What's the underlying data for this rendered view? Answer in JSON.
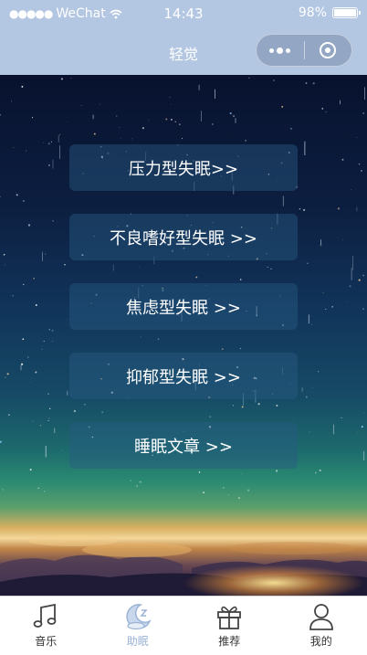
{
  "status_bar": {
    "carrier": "WeChat",
    "time": "14:43",
    "battery": "98%",
    "battery_level": 0.98
  },
  "nav": {
    "title": "轻觉"
  },
  "menu": [
    {
      "label": "压力型失眠>>"
    },
    {
      "label": "不良嗜好型失眠 >>"
    },
    {
      "label": "焦虑型失眠 >>"
    },
    {
      "label": "抑郁型失眠 >>"
    },
    {
      "label": "睡眠文章 >>"
    }
  ],
  "tabs": [
    {
      "label": "音乐",
      "icon": "music-icon",
      "active": false
    },
    {
      "label": "助眠",
      "icon": "moon-icon",
      "active": true
    },
    {
      "label": "推荐",
      "icon": "gift-icon",
      "active": false
    },
    {
      "label": "我的",
      "icon": "person-icon",
      "active": false
    }
  ],
  "colors": {
    "nav_bg": "#b3c6e2",
    "active_tab": "#9ab3d6",
    "button_bg": "rgba(40,90,130,0.45)"
  }
}
